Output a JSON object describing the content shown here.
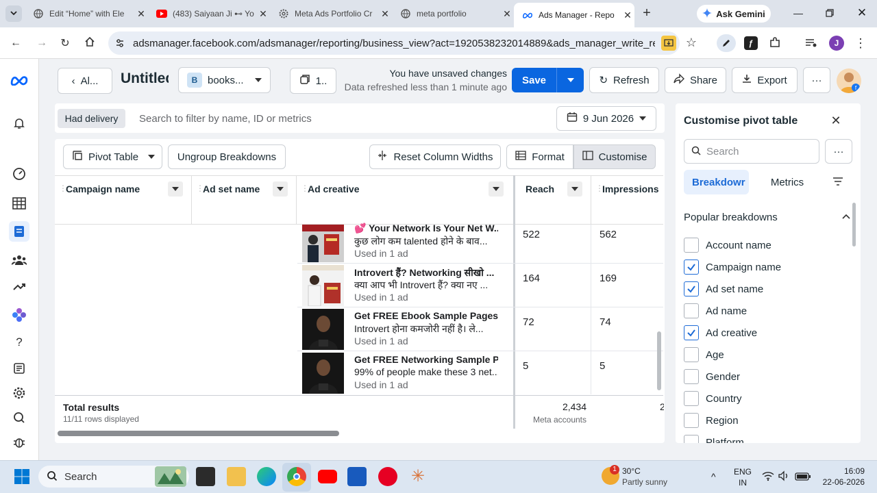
{
  "browser": {
    "tabs": [
      {
        "title": "Edit “Home” with Ele"
      },
      {
        "title": "(483) Saiyaan Ji ⊷ Yo"
      },
      {
        "title": "Meta Ads Portfolio Cr"
      },
      {
        "title": "meta portfolio"
      },
      {
        "title": "Ads Manager - Repo"
      }
    ],
    "gemini_label": "Ask Gemini",
    "url": "adsmanager.facebook.com/adsmanager/reporting/business_view?act=1920538232014889&ads_manager_write_regions=...",
    "profile_initial": "J"
  },
  "header": {
    "back_label": "Al...",
    "report_title": "Untitled",
    "account_badge": "B",
    "account_name": "books...",
    "copies_label": "1..",
    "unsaved": "You have unsaved changes",
    "refreshed": "Data refreshed less than 1 minute ago",
    "save_label": "Save",
    "refresh_label": "Refresh",
    "share_label": "Share",
    "export_label": "Export"
  },
  "filter": {
    "chip": "Had delivery",
    "placeholder": "Search to filter by name, ID or metrics",
    "date": "9 Jun 2026"
  },
  "tabletools": {
    "pivot": "Pivot Table",
    "ungroup": "Ungroup Breakdowns",
    "reset": "Reset Column Widths",
    "format": "Format",
    "customise": "Customise"
  },
  "columns": {
    "campaign": "Campaign name",
    "adset": "Ad set name",
    "creative": "Ad creative",
    "reach": "Reach",
    "impressions": "Impressions"
  },
  "rows": [
    {
      "title": "💕 Your Network Is Your Net W...",
      "body": "कुछ लोग कम talented होने के बाव...",
      "used": "Used in 1 ad",
      "reach": "522",
      "impressions": "562"
    },
    {
      "title": "Introvert हैं? Networking सीखो ...",
      "body": "क्या आप भी Introvert हैं? क्या नए ...",
      "used": "Used in 1 ad",
      "reach": "164",
      "impressions": "169"
    },
    {
      "title": "Get FREE Ebook Sample Pages",
      "body": "Introvert होना कमजोरी नहीं है। ले...",
      "used": "Used in 1 ad",
      "reach": "72",
      "impressions": "74"
    },
    {
      "title": "Get FREE Networking Sample P...",
      "body": "99% of people make these 3 net...",
      "used": "Used in 1 ad",
      "reach": "5",
      "impressions": "5"
    }
  ],
  "totals": {
    "label": "Total results",
    "rows_info": "11/11 rows displayed",
    "reach": "2,434",
    "reach_sub": "Meta accounts",
    "impressions_partial": "2"
  },
  "panel": {
    "title": "Customise pivot table",
    "search_placeholder": "Search",
    "tab_breakdowns": "Breakdowr",
    "tab_metrics": "Metrics",
    "section": "Popular breakdowns",
    "items": [
      {
        "label": "Account name",
        "checked": false
      },
      {
        "label": "Campaign name",
        "checked": true
      },
      {
        "label": "Ad set name",
        "checked": true
      },
      {
        "label": "Ad name",
        "checked": false
      },
      {
        "label": "Ad creative",
        "checked": true
      },
      {
        "label": "Age",
        "checked": false
      },
      {
        "label": "Gender",
        "checked": false
      },
      {
        "label": "Country",
        "checked": false
      },
      {
        "label": "Region",
        "checked": false
      },
      {
        "label": "Platform",
        "checked": false
      }
    ]
  },
  "taskbar": {
    "search": "Search",
    "weather_badge": "1",
    "temp": "30°C",
    "weather": "Partly sunny",
    "lang1": "ENG",
    "lang2": "IN",
    "time": "16:09",
    "date": "22-06-2026"
  },
  "colors": {
    "primary": "#0a66e0",
    "check": "#1d6bd6",
    "tabbar": "#dee3eb"
  }
}
